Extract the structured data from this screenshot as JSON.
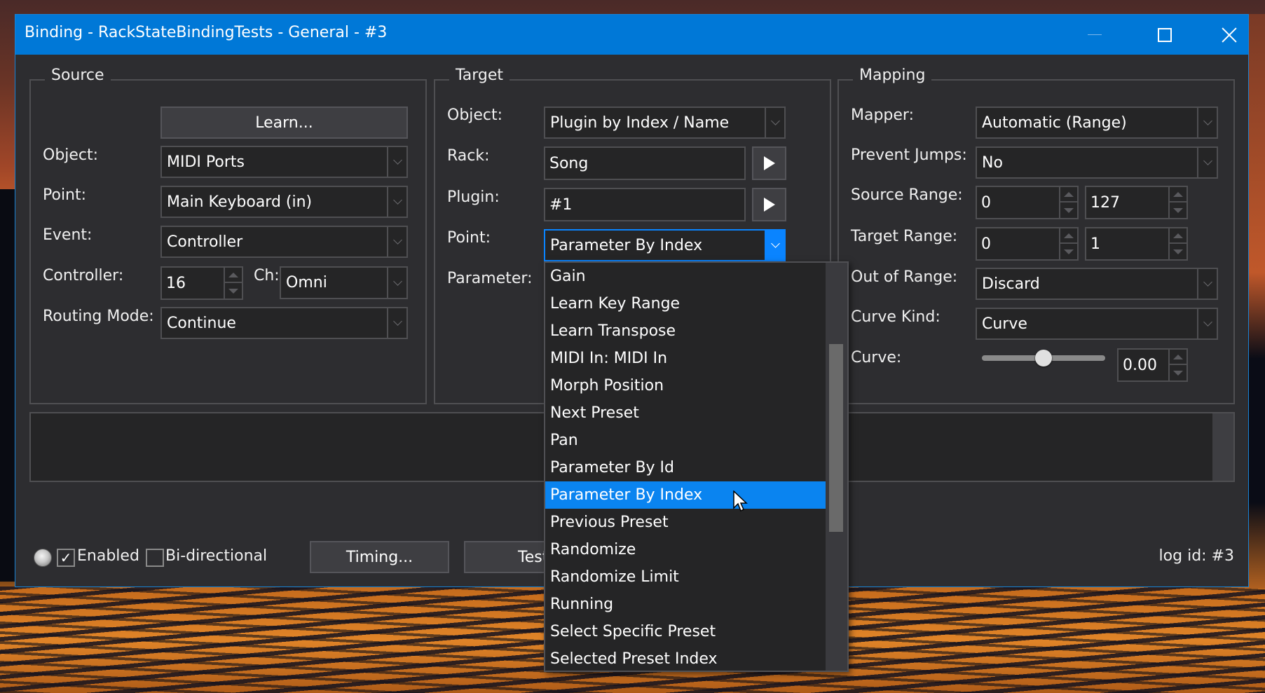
{
  "window": {
    "title": "Binding - RackStateBindingTests - General - #3",
    "controls": {
      "minimize": "minimize-icon",
      "maximize": "maximize-icon",
      "close": "close-icon"
    }
  },
  "source": {
    "title": "Source",
    "learn_label": "Learn...",
    "object_label": "Object:",
    "object_value": "MIDI Ports",
    "point_label": "Point:",
    "point_value": "Main Keyboard (in)",
    "event_label": "Event:",
    "event_value": "Controller",
    "controller_label": "Controller:",
    "controller_value": "16",
    "channel_label": "Ch:",
    "channel_value": "Omni",
    "routing_label": "Routing Mode:",
    "routing_value": "Continue"
  },
  "target": {
    "title": "Target",
    "object_label": "Object:",
    "object_value": "Plugin by Index / Name",
    "rack_label": "Rack:",
    "rack_value": "Song",
    "plugin_label": "Plugin:",
    "plugin_value": "#1",
    "point_label": "Point:",
    "point_value": "Parameter By Index",
    "parameter_label": "Parameter:"
  },
  "mapping": {
    "title": "Mapping",
    "mapper_label": "Mapper:",
    "mapper_value": "Automatic (Range)",
    "prevent_jumps_label": "Prevent Jumps:",
    "prevent_jumps_value": "No",
    "source_range_label": "Source Range:",
    "source_range_min": "0",
    "source_range_max": "127",
    "target_range_label": "Target Range:",
    "target_range_min": "0",
    "target_range_max": "1",
    "out_of_range_label": "Out of Range:",
    "out_of_range_value": "Discard",
    "curve_kind_label": "Curve Kind:",
    "curve_kind_value": "Curve",
    "curve_label": "Curve:",
    "curve_value": "0.00",
    "curve_slider_fraction": 0.5
  },
  "footer": {
    "enabled_label": "Enabled",
    "enabled_checked": true,
    "bidirectional_label": "Bi-directional",
    "bidirectional_checked": false,
    "timing_label": "Timing...",
    "test_label": "Test",
    "log_id": "log id: #3"
  },
  "point_dropdown": {
    "items": [
      "Gain",
      "Learn Key Range",
      "Learn Transpose",
      "MIDI In: MIDI In",
      "Morph Position",
      "Next Preset",
      "Pan",
      "Parameter By Id",
      "Parameter By Index",
      "Previous Preset",
      "Randomize",
      "Randomize Limit",
      "Running",
      "Select Specific Preset",
      "Selected Preset Index"
    ],
    "selected_index": 8,
    "scroll_thumb_start": 0.2,
    "scroll_thumb_end": 0.66
  },
  "colors": {
    "titlebar": "#0078d7",
    "accent": "#0a84f0",
    "panel": "#2d2d30",
    "field": "#252526"
  }
}
